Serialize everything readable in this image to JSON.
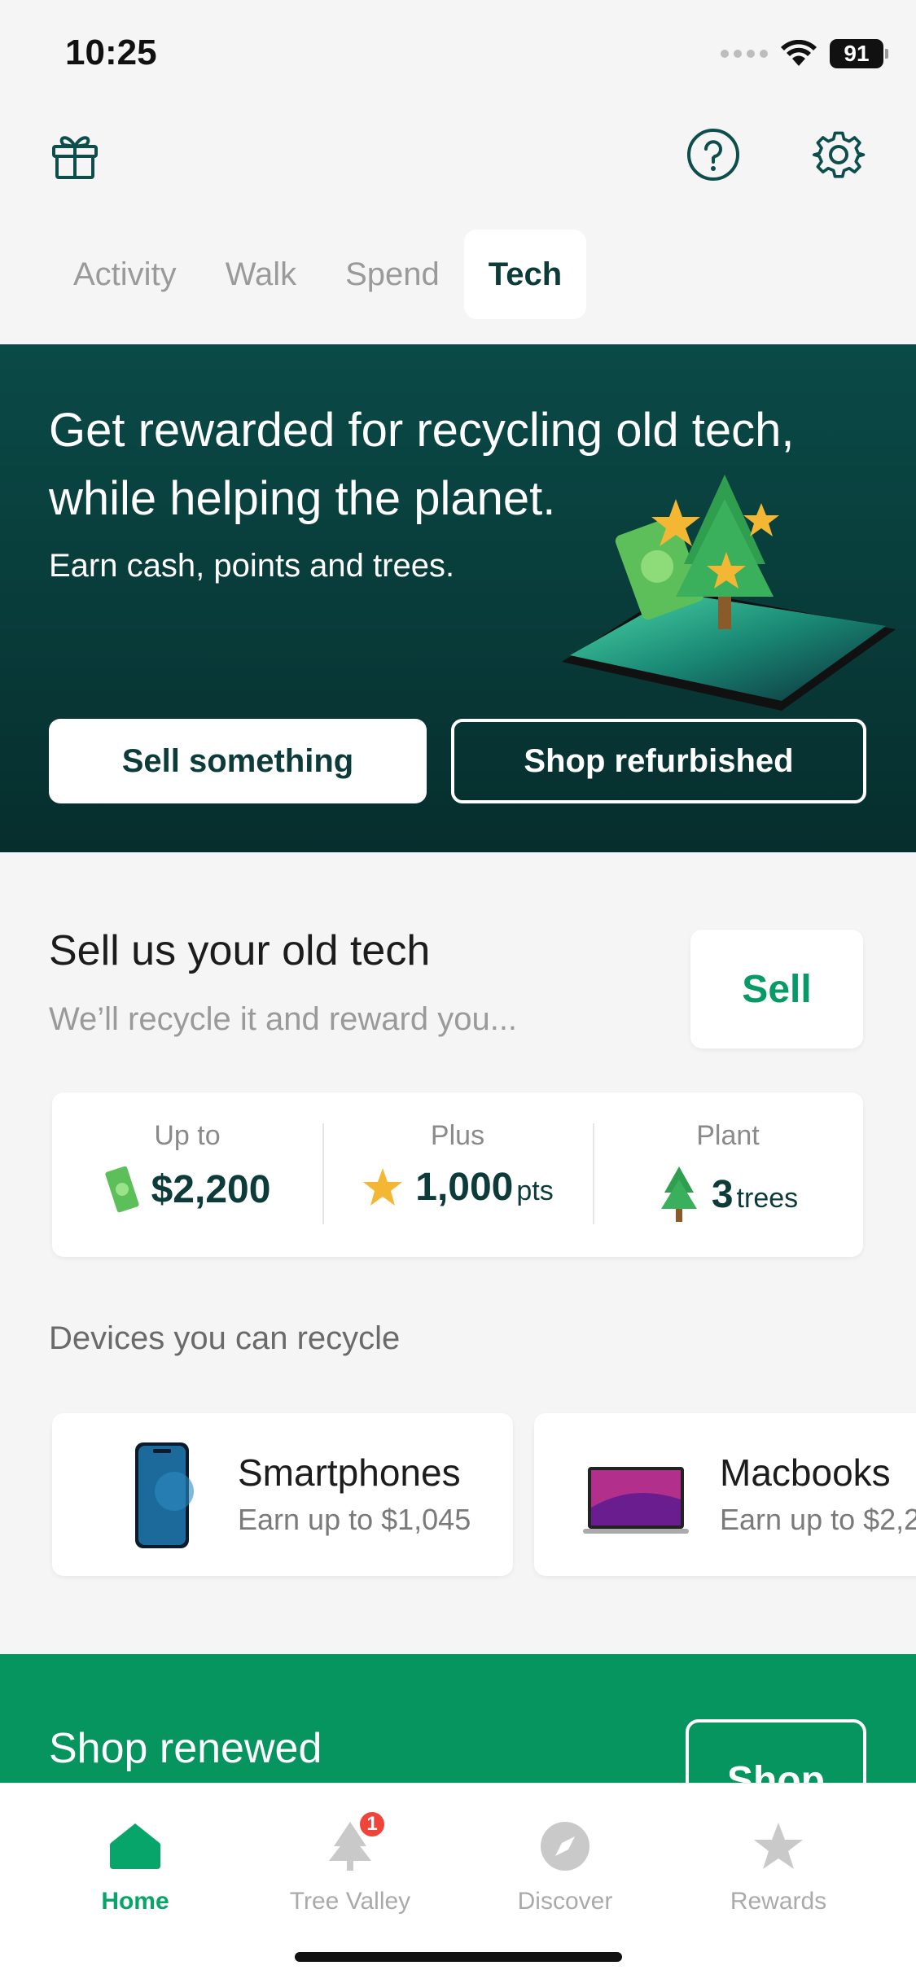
{
  "status_bar": {
    "time": "10:25",
    "battery": "91"
  },
  "tabs": [
    {
      "label": "Activity"
    },
    {
      "label": "Walk"
    },
    {
      "label": "Spend"
    },
    {
      "label": "Tech"
    }
  ],
  "hero": {
    "title": "Get rewarded for recycling old tech, while helping the planet.",
    "subtitle": "Earn cash, points and trees.",
    "primary_button": "Sell something",
    "secondary_button": "Shop refurbished"
  },
  "sell_section": {
    "title": "Sell us your old tech",
    "subtitle": "We’ll recycle it and reward you...",
    "button": "Sell"
  },
  "stats": [
    {
      "label": "Up to",
      "value": "$2,200",
      "unit": "",
      "icon": "cash-icon"
    },
    {
      "label": "Plus",
      "value": "1,000",
      "unit": "pts",
      "icon": "star-icon"
    },
    {
      "label": "Plant",
      "value": "3",
      "unit": "trees",
      "icon": "tree-icon"
    }
  ],
  "devices": {
    "heading": "Devices you can recycle",
    "items": [
      {
        "name": "Smartphones",
        "earn": "Earn up to $1,045",
        "icon": "smartphone-icon"
      },
      {
        "name": "Macbooks",
        "earn": "Earn up to $2,2",
        "icon": "laptop-icon"
      }
    ]
  },
  "shop_renewed": {
    "title": "Shop renewed",
    "button": "Shop"
  },
  "bottom_nav": [
    {
      "label": "Home",
      "icon": "home-icon",
      "active": true
    },
    {
      "label": "Tree Valley",
      "icon": "tree-icon",
      "badge": "1"
    },
    {
      "label": "Discover",
      "icon": "compass-icon"
    },
    {
      "label": "Rewards",
      "icon": "star-icon"
    }
  ],
  "colors": {
    "brand_dark": "#0d3b3a",
    "brand_green": "#06945f",
    "accent_green": "#07a56a",
    "badge_red": "#f0443b"
  }
}
